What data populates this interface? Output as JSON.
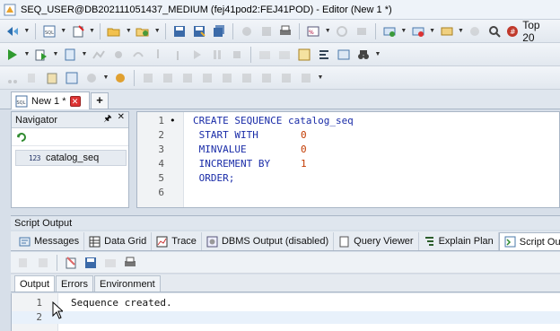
{
  "window": {
    "title": "SEQ_USER@DB202111051437_MEDIUM (fej41pod2:FEJ41POD) - Editor (New 1 *)"
  },
  "toolbar": {
    "top_label": "Top 20"
  },
  "document_tabs": [
    {
      "label": "New 1 *",
      "icon": "sql-file-icon"
    }
  ],
  "navigator": {
    "title": "Navigator",
    "items": [
      {
        "label": "catalog_seq",
        "icon": "sequence-icon",
        "icon_text": "123"
      }
    ]
  },
  "editor": {
    "lines": [
      {
        "num": "1",
        "marker": "•",
        "text": "CREATE SEQUENCE catalog_seq",
        "value": ""
      },
      {
        "num": "2",
        "marker": "",
        "text": " START WITH",
        "value": "0"
      },
      {
        "num": "3",
        "marker": "",
        "text": " MINVALUE",
        "value": "0"
      },
      {
        "num": "4",
        "marker": "",
        "text": " INCREMENT BY",
        "value": "1"
      },
      {
        "num": "5",
        "marker": "",
        "text": " ORDER;",
        "value": ""
      },
      {
        "num": "6",
        "marker": "",
        "text": "",
        "value": ""
      }
    ]
  },
  "script_output": {
    "title": "Script Output",
    "tabs": [
      {
        "label": "Messages",
        "icon": "messages-icon"
      },
      {
        "label": "Data Grid",
        "icon": "data-grid-icon"
      },
      {
        "label": "Trace",
        "icon": "trace-icon"
      },
      {
        "label": "DBMS Output (disabled)",
        "icon": "dbms-output-icon"
      },
      {
        "label": "Query Viewer",
        "icon": "query-viewer-icon"
      },
      {
        "label": "Explain Plan",
        "icon": "explain-plan-icon"
      },
      {
        "label": "Script Output",
        "icon": "script-output-icon"
      }
    ],
    "subtabs": [
      "Output",
      "Errors",
      "Environment"
    ],
    "lines": [
      {
        "num": "1",
        "text": "Sequence created."
      },
      {
        "num": "2",
        "text": ""
      }
    ]
  },
  "colors": {
    "keyword": "#1a2ca8",
    "number": "#c23a00",
    "chrome": "#d7dfe9"
  }
}
